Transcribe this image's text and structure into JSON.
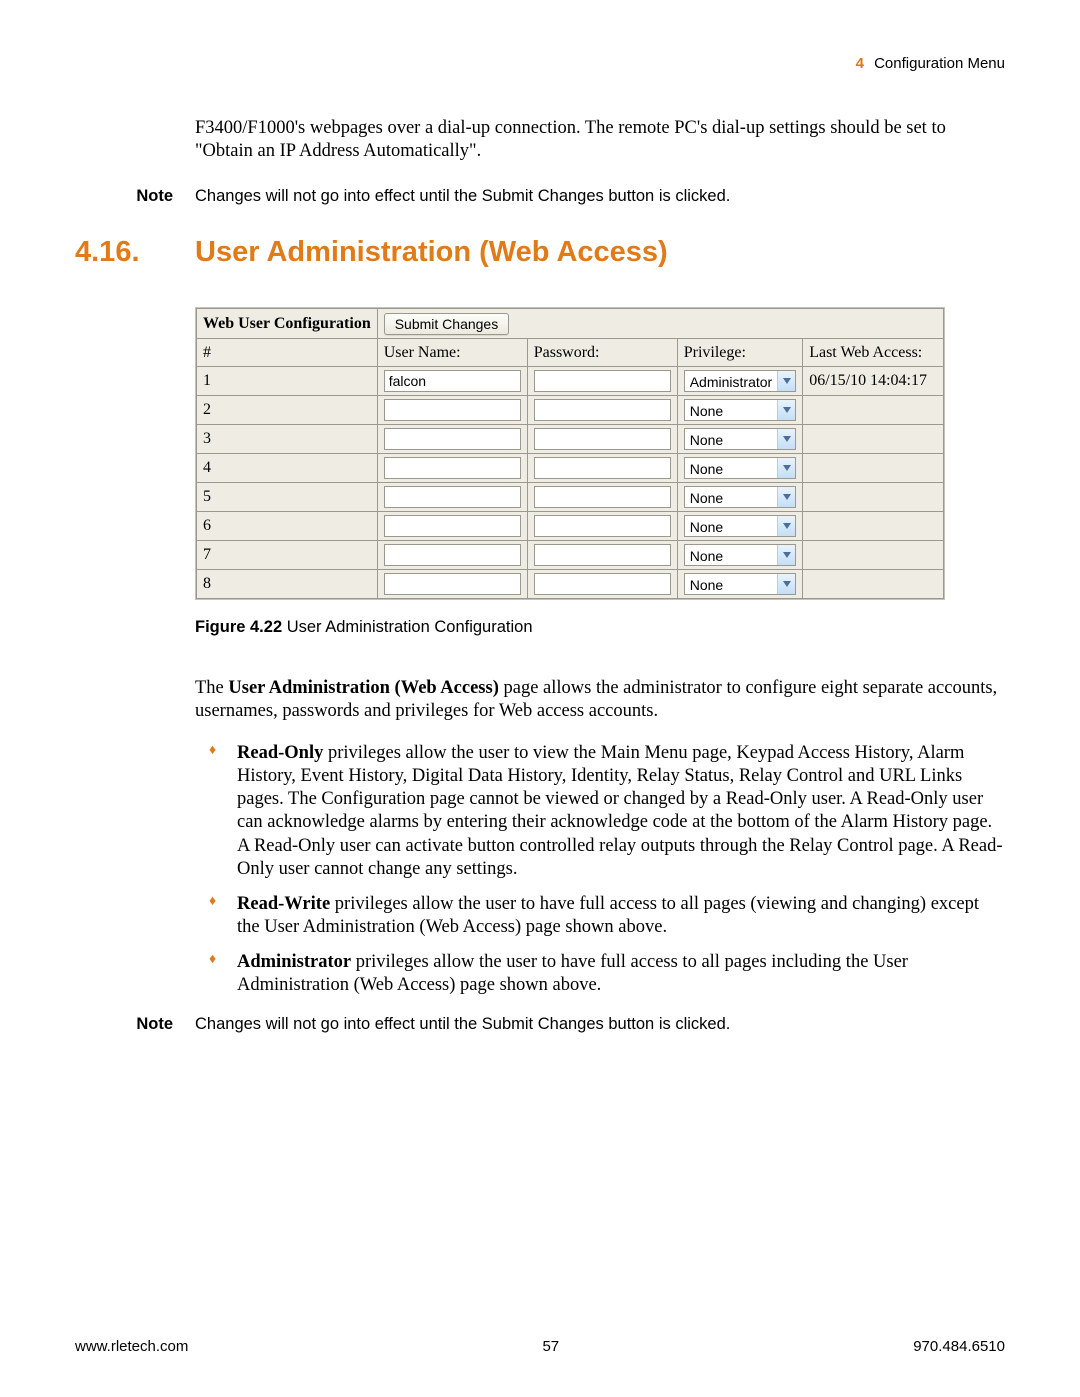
{
  "header": {
    "chapter_number": "4",
    "chapter_name": "Configuration Menu"
  },
  "intro_paragraph": "F3400/F1000's webpages over a dial-up connection. The remote PC's dial-up settings should be set to \"Obtain an IP Address Automatically\".",
  "note1": {
    "label": "Note",
    "text": "Changes will not go into effect until the Submit Changes button is clicked."
  },
  "section": {
    "number": "4.16.",
    "title": "User Administration (Web Access)"
  },
  "config_table": {
    "title": "Web User Configuration",
    "submit_label": "Submit Changes",
    "columns": {
      "num": "#",
      "username": "User Name:",
      "password": "Password:",
      "privilege": "Privilege:",
      "last": "Last Web Access:"
    },
    "rows": [
      {
        "num": "1",
        "username": "falcon",
        "password": "",
        "privilege": "Administrator",
        "last": "06/15/10 14:04:17"
      },
      {
        "num": "2",
        "username": "",
        "password": "",
        "privilege": "None",
        "last": ""
      },
      {
        "num": "3",
        "username": "",
        "password": "",
        "privilege": "None",
        "last": ""
      },
      {
        "num": "4",
        "username": "",
        "password": "",
        "privilege": "None",
        "last": ""
      },
      {
        "num": "5",
        "username": "",
        "password": "",
        "privilege": "None",
        "last": ""
      },
      {
        "num": "6",
        "username": "",
        "password": "",
        "privilege": "None",
        "last": ""
      },
      {
        "num": "7",
        "username": "",
        "password": "",
        "privilege": "None",
        "last": ""
      },
      {
        "num": "8",
        "username": "",
        "password": "",
        "privilege": "None",
        "last": ""
      }
    ]
  },
  "figure_caption": {
    "label": "Figure 4.22",
    "text": " User Administration Configuration"
  },
  "user_admin_para_prefix": "The ",
  "user_admin_para_bold": "User Administration (Web Access)",
  "user_admin_para_suffix": " page allows the administrator to configure eight separate accounts, usernames, passwords and privileges for Web access accounts.",
  "priv_read_only_bold": "Read-Only",
  "priv_read_only_text": " privileges allow the user to view the Main Menu page, Keypad Access History, Alarm History, Event History, Digital Data History, Identity, Relay Status, Relay Control and URL Links pages. The Configuration page cannot be viewed or changed by a Read-Only user. A Read-Only user can acknowledge alarms by entering their acknowledge code at the bottom of the Alarm History page. A Read-Only user can activate button controlled relay outputs through the Relay Control page. A Read-Only user cannot change any settings.",
  "priv_read_write_bold": "Read-Write",
  "priv_read_write_text": " privileges allow the user to have full access to all pages (viewing and changing) except the User Administration (Web Access) page shown above.",
  "priv_admin_bold": "Administrator",
  "priv_admin_text": " privileges allow the user to have full access to all pages including the User Administration (Web Access) page shown above.",
  "note2": {
    "label": "Note",
    "text": "Changes will not go into effect until the Submit Changes button is clicked."
  },
  "footer": {
    "left": "www.rletech.com",
    "center": "57",
    "right": "970.484.6510"
  }
}
